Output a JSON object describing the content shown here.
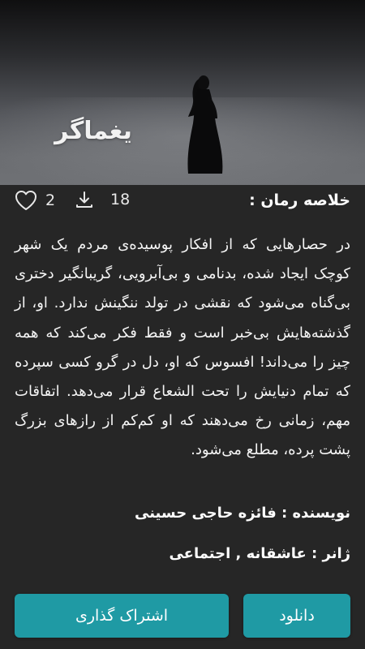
{
  "book": {
    "title": "یغماگر",
    "summary_label": "خلاصه رمان :",
    "likes": "2",
    "downloads": "18",
    "summary": "در حصارهایی که از افکار پوسیده‌ی مردم یک شهر کوچک ایجاد شده، بدنامی و بی‌آبرویی، گریبانگیر دختری بی‌گناه می‌شود  که نقشی در تولد ننگینش ندارد. او، از گذشته‌هایش بی‌خبر است و فقط فکر می‌کند که همه چیز را می‌داند! افسوس که او، دل در گرو کسی سپرده که تمام دنیایش را تحت الشعاع قرار می‌دهد. اتفاقات مهم،  زمانی رخ می‌دهند که او کم‌کم از رازهای بزرگ پشت پرده، مطلع می‌شود.",
    "author_line": "نویسنده : فائزه حاجی حسینی",
    "genre_line": "ژانر : عاشقانه , اجتماعی"
  },
  "actions": {
    "download_label": "دانلود",
    "share_label": "اشتراک گذاری"
  },
  "icons": {
    "likes": "heart-icon",
    "downloads": "download-icon"
  },
  "colors": {
    "background": "#262626",
    "button": "#1f9aa4"
  }
}
